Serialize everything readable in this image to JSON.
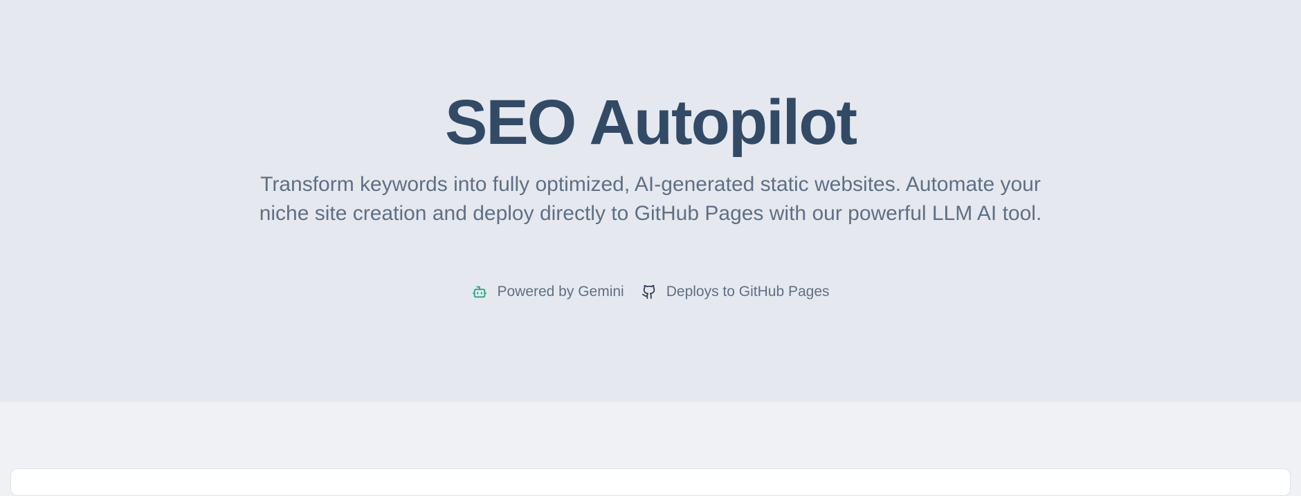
{
  "hero": {
    "title": "SEO Autopilot",
    "subtitle": "Transform keywords into fully optimized, AI-generated static websites. Automate your niche site creation and deploy directly to GitHub Pages with our powerful LLM AI tool.",
    "badges": [
      {
        "icon": "robot-icon",
        "label": "Powered by Gemini",
        "icon_color": "#22a87a"
      },
      {
        "icon": "github-icon",
        "label": "Deploys to GitHub Pages",
        "icon_color": "#2f3e52"
      }
    ]
  },
  "colors": {
    "hero_background": "#e5e9ef",
    "page_background": "#eff1f5",
    "title": "#334a66",
    "subtitle": "#5f6f84"
  }
}
